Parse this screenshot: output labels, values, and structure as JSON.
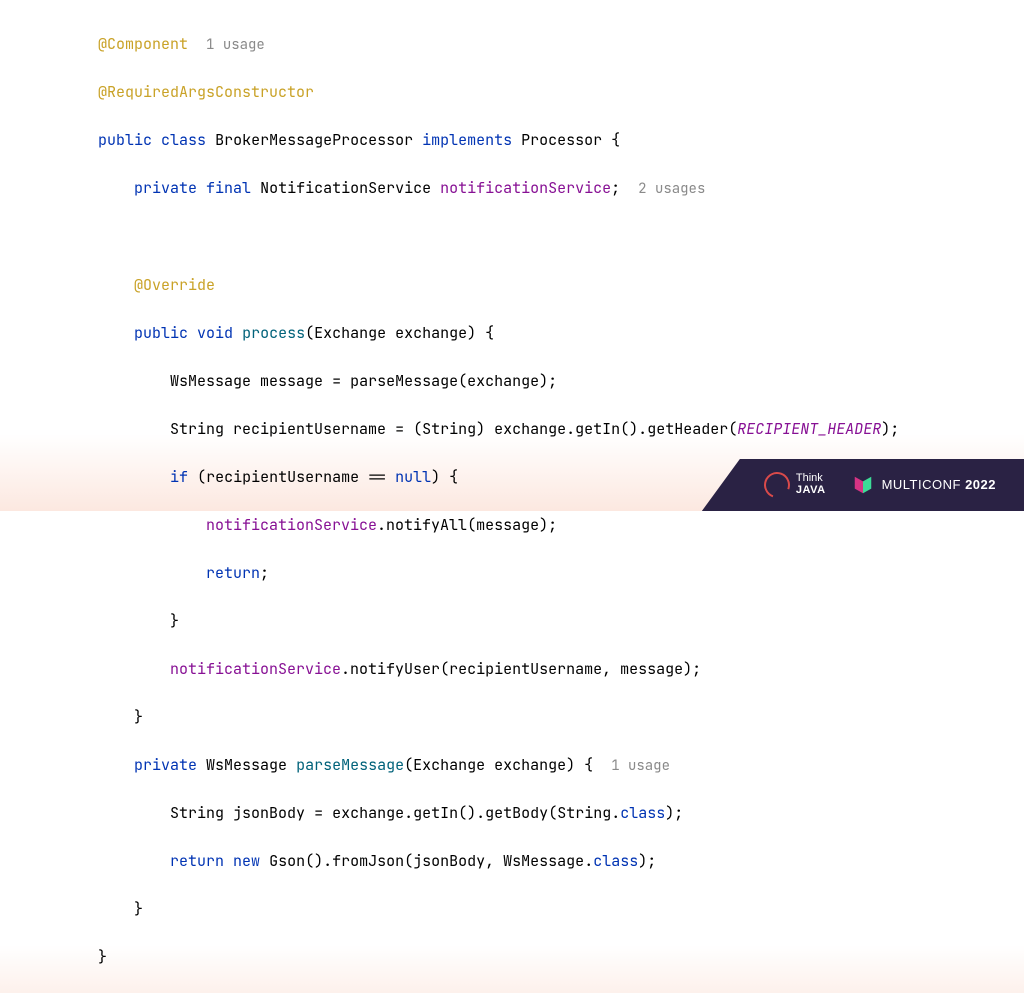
{
  "code": {
    "annotations": {
      "component": "@Component",
      "required_args": "@RequiredArgsConstructor",
      "override": "@Override"
    },
    "inlays": {
      "component_usage": "1 usage",
      "field_usage": "2 usages",
      "parse_usage": "1 usage"
    },
    "decl": {
      "public": "public",
      "class_kw": "class",
      "class_name": "BrokerMessageProcessor",
      "implements": "implements",
      "interface": "Processor",
      "private": "private",
      "final": "final",
      "svc_type": "NotificationService",
      "svc_field": "notificationService",
      "void": "void",
      "process": "process",
      "exchange_type": "Exchange",
      "exchange_param": "exchange",
      "wsmsg_type": "WsMessage",
      "message_var": "message",
      "parse_call": "parseMessage",
      "string_type": "String",
      "recipient_var": "recipientUsername",
      "cast_string": "String",
      "get_in": "getIn",
      "get_header": "getHeader",
      "recipient_const": "RECIPIENT_HEADER",
      "if_kw": "if",
      "null_kw": "null",
      "notify_all": "notifyAll",
      "return_kw": "return",
      "notify_user": "notifyUser",
      "parse_message": "parseMessage",
      "json_body": "jsonBody",
      "get_body": "getBody",
      "class_ref": "class",
      "new_kw": "new",
      "gson": "Gson",
      "from_json": "fromJson"
    }
  },
  "footer": {
    "thinkjava": {
      "line1": "Think",
      "line2": "JAVA"
    },
    "multiconf": {
      "name": "MULTICONF",
      "year": "2022"
    }
  }
}
